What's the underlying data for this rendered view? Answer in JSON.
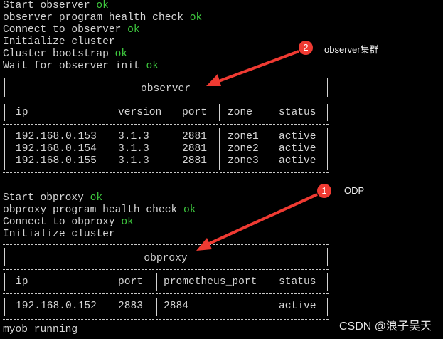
{
  "terminal": {
    "lines_top": [
      {
        "text": "Start observer ",
        "status": "ok"
      },
      {
        "text": "observer program health check ",
        "status": "ok"
      },
      {
        "text": "Connect to observer ",
        "status": "ok"
      },
      {
        "text": "Initialize cluster",
        "status": ""
      },
      {
        "text": "Cluster bootstrap ",
        "status": "ok"
      },
      {
        "text": "Wait for observer init ",
        "status": "ok"
      }
    ],
    "observer_table": {
      "title": "observer",
      "headers": [
        "ip",
        "version",
        "port",
        "zone",
        "status"
      ],
      "rows": [
        [
          "192.168.0.153",
          "3.1.3",
          "2881",
          "zone1",
          "active"
        ],
        [
          "192.168.0.154",
          "3.1.3",
          "2881",
          "zone2",
          "active"
        ],
        [
          "192.168.0.155",
          "3.1.3",
          "2881",
          "zone3",
          "active"
        ]
      ]
    },
    "lines_mid": [
      {
        "text": "Start obproxy ",
        "status": "ok"
      },
      {
        "text": "obproxy program health check ",
        "status": "ok"
      },
      {
        "text": "Connect to obproxy ",
        "status": "ok"
      },
      {
        "text": "Initialize cluster",
        "status": ""
      }
    ],
    "obproxy_table": {
      "title": "obproxy",
      "headers": [
        "ip",
        "port",
        "prometheus_port",
        "status"
      ],
      "rows": [
        [
          "192.168.0.152",
          "2883",
          "2884",
          "active"
        ]
      ]
    },
    "lines_bottom": [
      {
        "text": "myob running",
        "status": ""
      }
    ]
  },
  "annotations": [
    {
      "number": "2",
      "label": "observer集群"
    },
    {
      "number": "1",
      "label": "ODP"
    }
  ],
  "watermark": "CSDN @浪子吴天",
  "colors": {
    "ok": "#3ec93e",
    "arrow": "#ef3a32",
    "background": "#000000"
  }
}
